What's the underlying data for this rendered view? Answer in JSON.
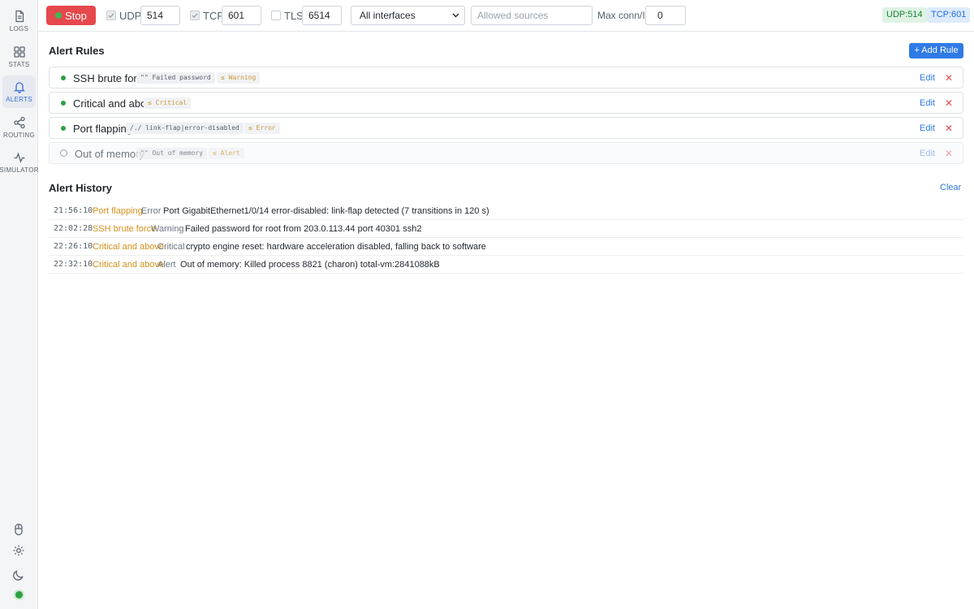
{
  "sidebar": {
    "items": [
      {
        "label": "LOGS",
        "icon": "document-icon"
      },
      {
        "label": "STATS",
        "icon": "grid-icon"
      },
      {
        "label": "ALERTS",
        "icon": "bell-icon"
      },
      {
        "label": "ROUTING",
        "icon": "share-icon"
      },
      {
        "label": "SIMULATOR",
        "icon": "pulse-icon"
      }
    ],
    "active": "ALERTS"
  },
  "toolbar": {
    "stop_label": "Stop",
    "udp_label": "UDP",
    "udp_port": "514",
    "tcp_label": "TCP",
    "tcp_port": "601",
    "tls_label": "TLS",
    "tls_port": "6514",
    "interface_value": "All interfaces",
    "sources_placeholder": "Allowed sources",
    "max_conn_label": "Max conn/IP",
    "max_conn_value": "0",
    "udp_badge": "UDP:514",
    "tcp_badge": "TCP:601"
  },
  "alert_rules": {
    "title": "Alert Rules",
    "add_label": "+ Add Rule",
    "edit_label": "Edit",
    "delete_glyph": "✕",
    "rules": [
      {
        "name": "SSH brute force",
        "match": "\"\" Failed password",
        "severity": "≤ Warning",
        "enabled": true
      },
      {
        "name": "Critical and above",
        "match": "",
        "severity": "≤ Critical",
        "enabled": true
      },
      {
        "name": "Port flapping",
        "match": "/./ link-flap|error-disabled",
        "severity": "≤ Error",
        "enabled": true
      },
      {
        "name": "Out of memory",
        "match": "\"\" Out of memory",
        "severity": "≤ Alert",
        "enabled": false
      }
    ]
  },
  "alert_history": {
    "title": "Alert History",
    "clear_label": "Clear",
    "entries": [
      {
        "time": "21:56:10",
        "rule": "Port flapping",
        "severity": "Error",
        "message": "Port GigabitEthernet1/0/14 error-disabled: link-flap detected (7 transitions in 120 s)"
      },
      {
        "time": "22:02:28",
        "rule": "SSH brute force",
        "severity": "Warning",
        "message": "Failed password for root from 203.0.113.44 port 40301 ssh2"
      },
      {
        "time": "22:26:10",
        "rule": "Critical and above",
        "severity": "Critical",
        "message": "crypto engine reset: hardware acceleration disabled, falling back to software"
      },
      {
        "time": "22:32:10",
        "rule": "Critical and above",
        "severity": "Alert",
        "message": "Out of memory: Killed process 8821 (charon) total-vm:2841088kB"
      }
    ]
  }
}
